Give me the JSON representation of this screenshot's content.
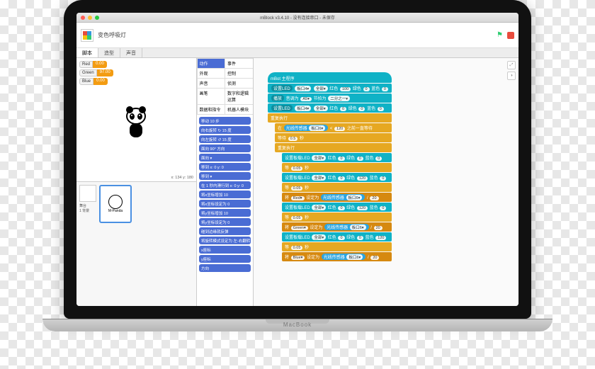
{
  "titlebar": {
    "title": "mBlock v3.4.10 - 没有连接串口 - 未保存"
  },
  "toolbar": {
    "project": "变色呼吸灯"
  },
  "tabs": [
    "脚本",
    "造型",
    "声音"
  ],
  "vars": [
    {
      "label": "Red",
      "value": "0.00"
    },
    {
      "label": "Green",
      "value": "97.00"
    },
    {
      "label": "Blue",
      "value": "0.00"
    }
  ],
  "stage_coords": "x: 134  y: 180",
  "sprite_name": "M-Panda",
  "backdrop_label": "舞台\n1 背景",
  "categories": [
    {
      "name": "动作",
      "cls": "c-blue"
    },
    {
      "name": "事件",
      "cls": ""
    },
    {
      "name": "外观",
      "cls": ""
    },
    {
      "name": "控制",
      "cls": ""
    },
    {
      "name": "声音",
      "cls": ""
    },
    {
      "name": "侦测",
      "cls": ""
    },
    {
      "name": "画笔",
      "cls": ""
    },
    {
      "name": "数字和逻辑运算",
      "cls": ""
    },
    {
      "name": "数据和指令",
      "cls": ""
    },
    {
      "name": "机器人模块",
      "cls": ""
    }
  ],
  "palette": [
    "移动 10 步",
    "向右旋转 ↻ 15 度",
    "向左旋转 ↺ 15 度",
    "面向 90° 方向",
    "面向 ▾",
    "移到 x: 0 y: 0",
    "移到 ▾",
    "在 1 秒内滑行到 x: 0 y: 0",
    "将x坐标增加 10",
    "将x坐标设定为 0",
    "将y坐标增加 10",
    "将y坐标设定为 0",
    "碰到边缘就反弹",
    "将旋转模式设定为 左-右翻转 ▾",
    "x座标",
    "y座标",
    "方向"
  ],
  "script": [
    {
      "c": "c-teal",
      "cls": "hat",
      "t": "mBot 主程序"
    },
    {
      "c": "c-teal",
      "t": "<span class='dark'>设置LED</span> <span class='pill'>板口4▾</span> <span class='pill'>全部▾</span> 红色 <span class='pill'>100</span> 绿色 <span class='pill'>0</span> 蓝色 <span class='pill'>0</span>"
    },
    {
      "c": "c-teal",
      "t": "<span class='dark'>播放</span> 音调为 <span class='pill'>A5▾</span> 节拍为 <span class='pill'>二分之一▾</span>"
    },
    {
      "c": "c-teal",
      "t": "<span class='dark'>设置LED</span> <span class='pill'>板口4▾</span> <span class='pill'>全部▾</span> 红色 <span class='pill'>0</span> 绿色 <span class='pill'>0</span> 蓝色 <span class='pill'>0</span>"
    },
    {
      "c": "c-ora",
      "t": "重复执行"
    },
    {
      "c": "c-ora",
      "ind": 1,
      "t": "在 <span class='oval sensor'>光线传感器 <span class='pill'>板口6▾</span></span> &lt; <span class='pill'>120</span> 之前一直等待"
    },
    {
      "c": "c-ora",
      "ind": 1,
      "t": "等待 <span class='pill'>0.5</span> 秒"
    },
    {
      "c": "c-ora",
      "ind": 1,
      "t": "重复执行"
    },
    {
      "c": "c-teal",
      "ind": 2,
      "t": "设置板载LED <span class='pill'>全部▾</span> 红色 <span class='pill'>0</span> 绿色 <span class='pill'>0</span> 蓝色 <span class='pill'>0</span>"
    },
    {
      "c": "c-ora",
      "ind": 2,
      "t": "等 <span class='pill'>0.05</span> 秒"
    },
    {
      "c": "c-teal",
      "ind": 2,
      "t": "设置板载LED <span class='pill'>全部▾</span> 红色 <span class='pill'>0</span> 绿色 <span class='pill'>120</span> 蓝色 <span class='pill'>0</span>"
    },
    {
      "c": "c-ora",
      "ind": 2,
      "t": "等 <span class='pill'>0.05</span> 秒"
    },
    {
      "c": "c-dora",
      "ind": 2,
      "t": "将 <span class='pill'>Red▾</span> 设定为 <span class='oval sensor'>光线传感器 <span class='pill'>板口6▾</span></span> / <span class='pill'>20</span>"
    },
    {
      "c": "c-teal",
      "ind": 2,
      "t": "设置板载LED <span class='pill'>全部▾</span> 红色 <span class='pill'>0</span> 绿色 <span class='pill'>120</span> 蓝色 <span class='pill'>0</span>"
    },
    {
      "c": "c-ora",
      "ind": 2,
      "t": "等 <span class='pill'>0.05</span> 秒"
    },
    {
      "c": "c-dora",
      "ind": 2,
      "t": "将 <span class='pill'>Green▾</span> 设定为 <span class='oval sensor'>光线传感器 <span class='pill'>板口6▾</span></span> / <span class='pill'>20</span>"
    },
    {
      "c": "c-teal",
      "ind": 2,
      "t": "设置板载LED <span class='pill'>全部▾</span> 红色 <span class='pill'>0</span> 绿色 <span class='pill'>0</span> 蓝色 <span class='pill'>120</span>"
    },
    {
      "c": "c-ora",
      "ind": 2,
      "t": "等 <span class='pill'>0.05</span> 秒"
    },
    {
      "c": "c-dora",
      "ind": 2,
      "t": "将 <span class='pill'>Blue▾</span> 设定为 <span class='oval sensor'>光线传感器 <span class='pill'>板口6▾</span></span> / <span class='pill'>20</span>"
    }
  ],
  "macbook": "MacBook"
}
